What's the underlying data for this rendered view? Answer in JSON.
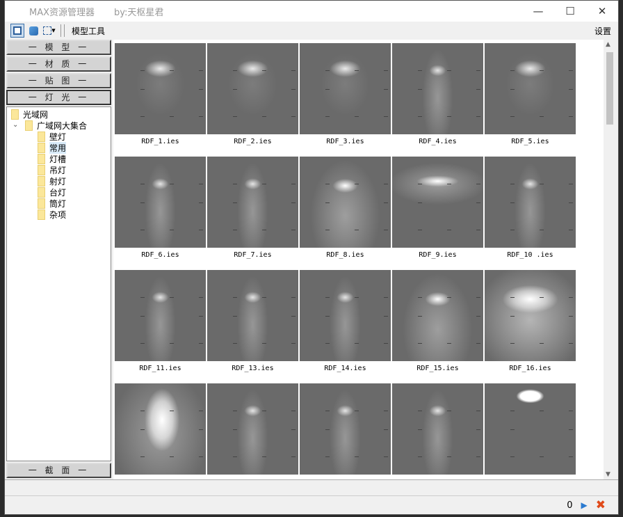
{
  "window": {
    "title": "MAX资源管理器",
    "author": "by:天枢星君",
    "minimize": "—",
    "maximize": "☐",
    "close": "✕"
  },
  "toolbar": {
    "model_tools": "模型工具",
    "settings": "设置"
  },
  "categories": [
    {
      "label": "一 模 型 一"
    },
    {
      "label": "一 材 质 一"
    },
    {
      "label": "一 贴 图 一"
    },
    {
      "label": "一 灯 光 一"
    }
  ],
  "bottom_category": "一 截 面 一",
  "tree": {
    "root": "光域网",
    "group": "广域网大集合",
    "children": [
      "壁灯",
      "常用",
      "灯槽",
      "吊灯",
      "射灯",
      "台灯",
      "筒灯",
      "杂项"
    ],
    "selected": "常用"
  },
  "items": [
    {
      "name": "RDF_1.ies",
      "beam": "soft"
    },
    {
      "name": "RDF_2.ies",
      "beam": "soft"
    },
    {
      "name": "RDF_3.ies",
      "beam": "soft"
    },
    {
      "name": "RDF_4.ies",
      "beam": "long"
    },
    {
      "name": "RDF_5.ies",
      "beam": "soft"
    },
    {
      "name": "RDF_6.ies",
      "beam": "long"
    },
    {
      "name": "RDF_7.ies",
      "beam": "long"
    },
    {
      "name": "RDF_8.ies",
      "beam": "wide"
    },
    {
      "name": "RDF_9.ies",
      "beam": "flat"
    },
    {
      "name": "RDF_10 .ies",
      "beam": "long"
    },
    {
      "name": "RDF_11.ies",
      "beam": "long"
    },
    {
      "name": "RDF_13.ies",
      "beam": "long"
    },
    {
      "name": "RDF_14.ies",
      "beam": "long"
    },
    {
      "name": "RDF_15.ies",
      "beam": "wide"
    },
    {
      "name": "RDF_16.ies",
      "beam": "huge"
    },
    {
      "name": "",
      "beam": "blob"
    },
    {
      "name": "",
      "beam": "long"
    },
    {
      "name": "",
      "beam": "long"
    },
    {
      "name": "",
      "beam": "long"
    },
    {
      "name": "",
      "beam": "top"
    }
  ],
  "status": {
    "count": "0"
  }
}
